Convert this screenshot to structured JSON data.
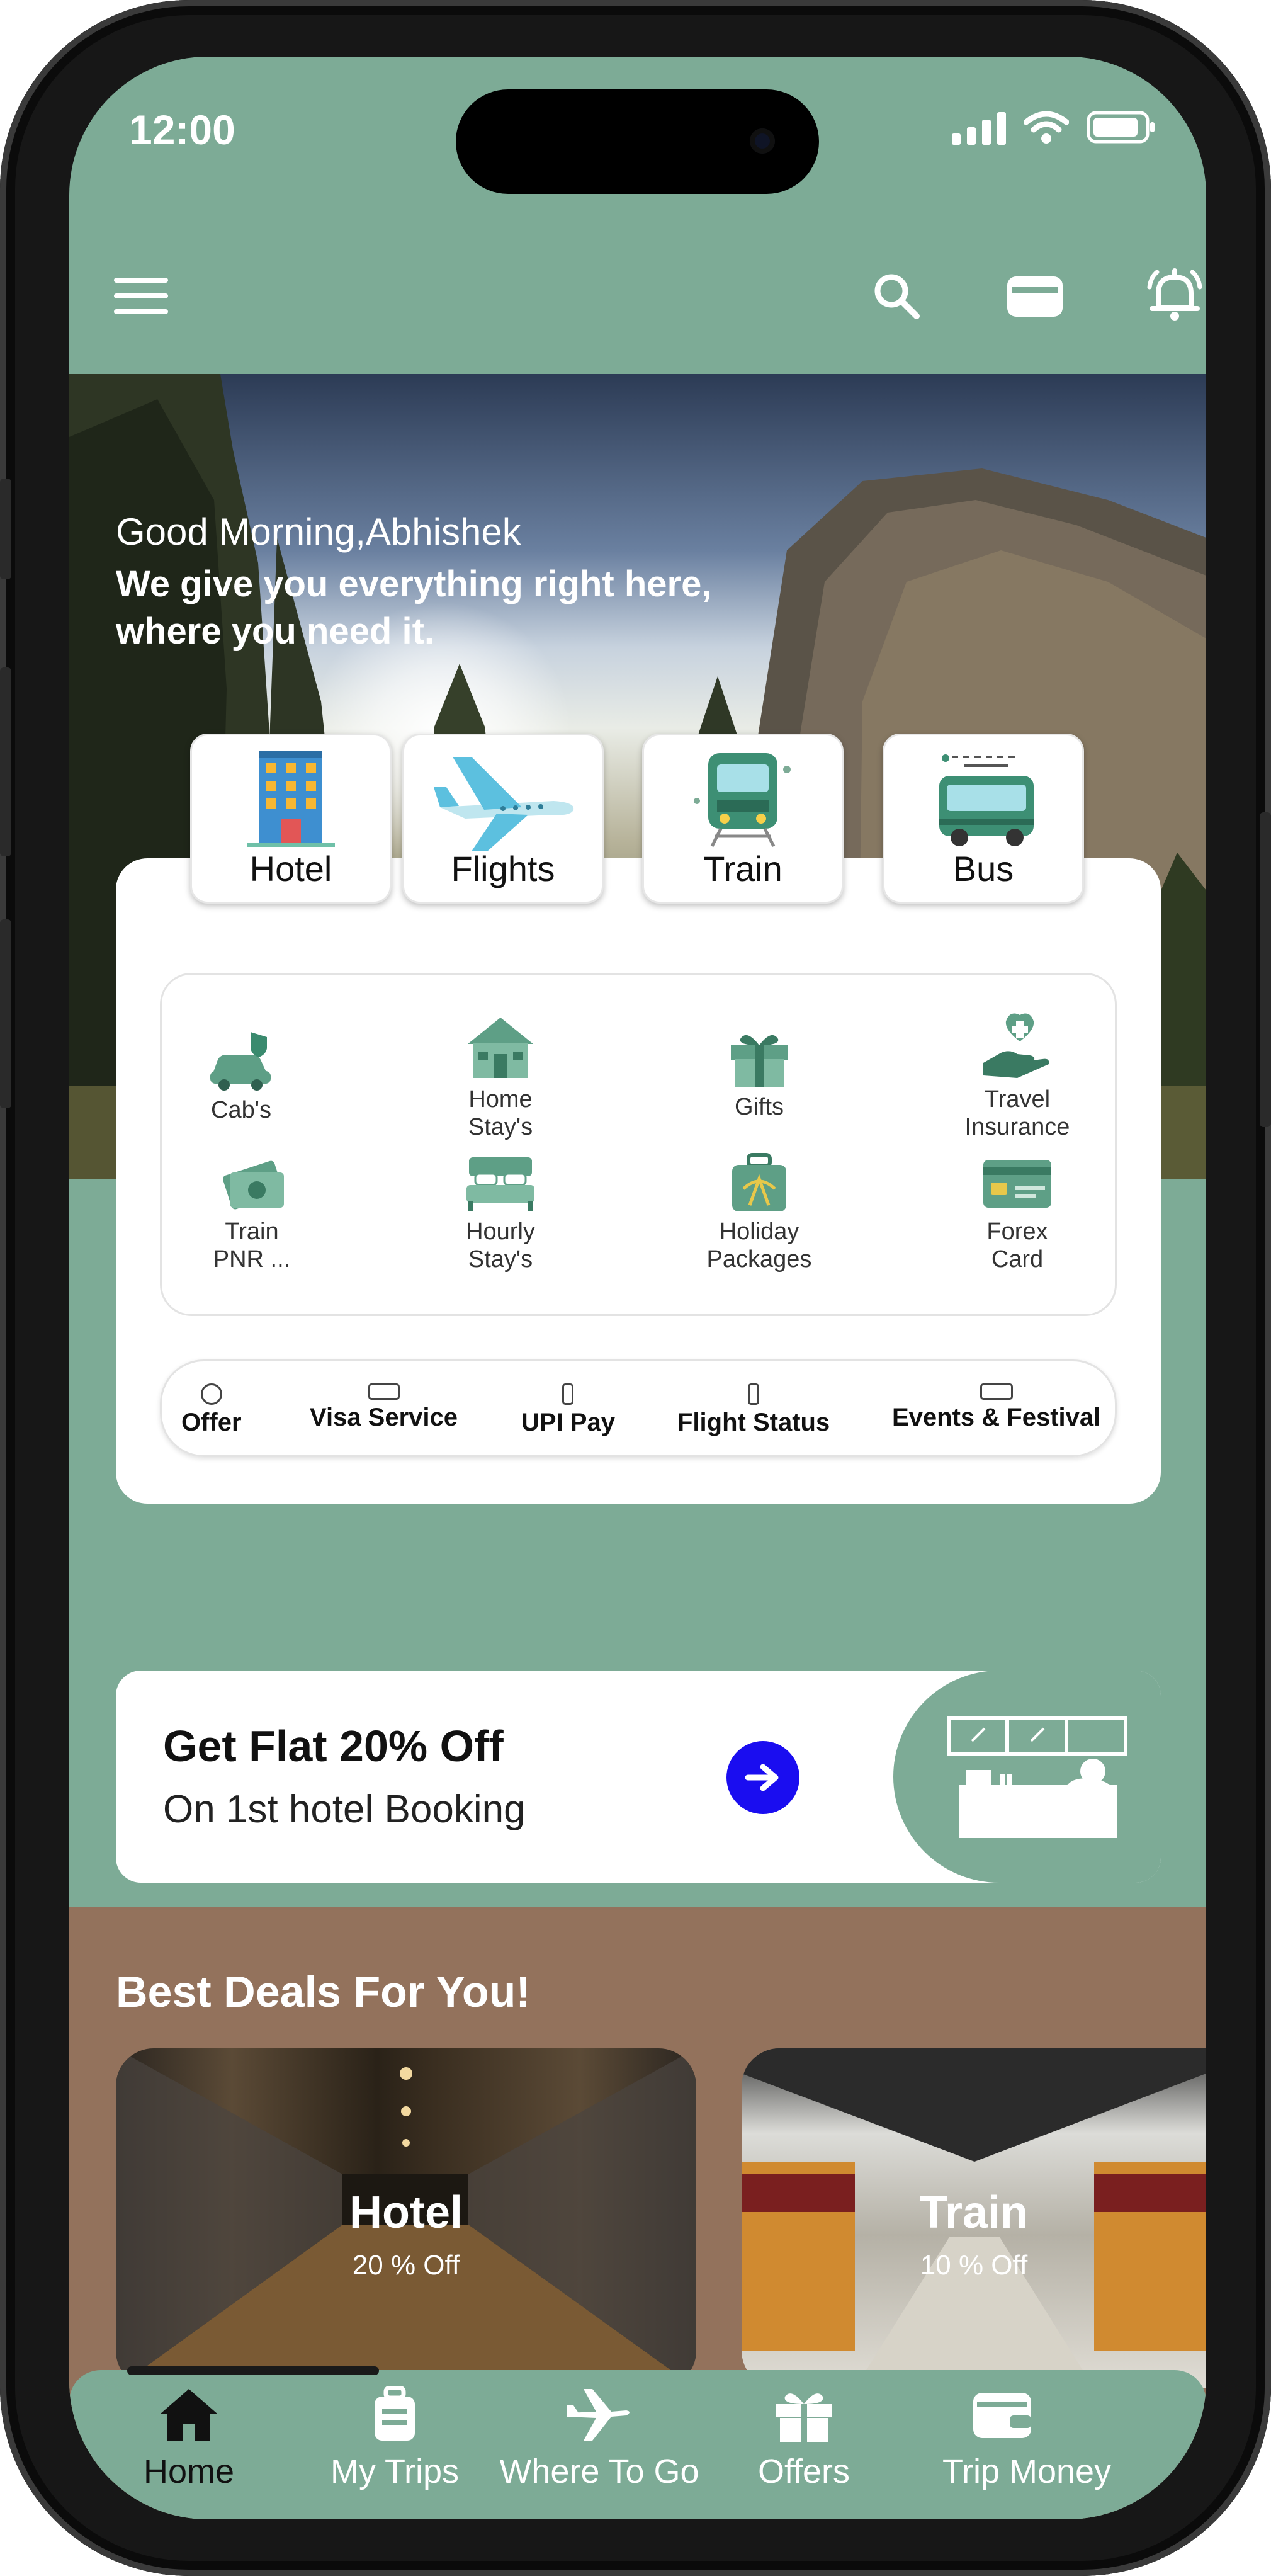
{
  "status_bar": {
    "time": "12:00"
  },
  "header": {
    "icons": [
      "menu-icon",
      "search-icon",
      "wallet-icon",
      "bell-icon"
    ]
  },
  "hero": {
    "greeting": "Good Morning,Abhishek",
    "tagline": "We give you everything right here, where you need it."
  },
  "categories": [
    {
      "label": "Hotel",
      "icon": "hotel-building-icon"
    },
    {
      "label": "Flights",
      "icon": "airplane-icon"
    },
    {
      "label": "Train",
      "icon": "train-icon"
    },
    {
      "label": "Bus",
      "icon": "bus-icon"
    }
  ],
  "services": [
    {
      "line1": "Cab's",
      "line2": "",
      "icon": "cab-icon"
    },
    {
      "line1": "Home",
      "line2": "Stay's",
      "icon": "home-stay-icon"
    },
    {
      "line1": "Gifts",
      "line2": "",
      "icon": "gift-icon"
    },
    {
      "line1": "Travel",
      "line2": "Insurance",
      "icon": "insurance-icon"
    },
    {
      "line1": "Train",
      "line2": "PNR ...",
      "icon": "train-ticket-icon"
    },
    {
      "line1": "Hourly",
      "line2": "Stay's",
      "icon": "bed-icon"
    },
    {
      "line1": "Holiday",
      "line2": "Packages",
      "icon": "holiday-bag-icon"
    },
    {
      "line1": "Forex",
      "line2": "Card",
      "icon": "forex-card-icon"
    }
  ],
  "quick_links": [
    {
      "label": "Offer",
      "icon": "offer-icon"
    },
    {
      "label": "Visa Service",
      "icon": "visa-icon"
    },
    {
      "label": "UPI Pay",
      "icon": "phone-icon"
    },
    {
      "label": "Flight Status",
      "icon": "phone-icon"
    },
    {
      "label": "Events & Festival",
      "icon": "ticket-icon"
    }
  ],
  "promo": {
    "title": "Get Flat 20% Off",
    "subtitle": "On 1st hotel Booking",
    "arrow_icon": "arrow-right-icon",
    "illustration": "hotel-reception-icon"
  },
  "deals": {
    "heading": "Best Deals For You!",
    "items": [
      {
        "name": "Hotel",
        "offer": "20 % Off"
      },
      {
        "name": "Train",
        "offer": "10 % Off"
      }
    ]
  },
  "tab_bar": {
    "items": [
      {
        "label": "Home",
        "icon": "home-icon",
        "active": true
      },
      {
        "label": "My Trips",
        "icon": "luggage-icon",
        "active": false
      },
      {
        "label": "Where To Go",
        "icon": "plane-icon",
        "active": false
      },
      {
        "label": "Offers",
        "icon": "gift-icon",
        "active": false
      },
      {
        "label": "Trip Money",
        "icon": "wallet-icon",
        "active": false
      }
    ]
  },
  "colors": {
    "primary": "#7dab96",
    "deals_bg": "#93725c",
    "promo_arrow": "#1a0df0",
    "card": "#ffffff"
  }
}
